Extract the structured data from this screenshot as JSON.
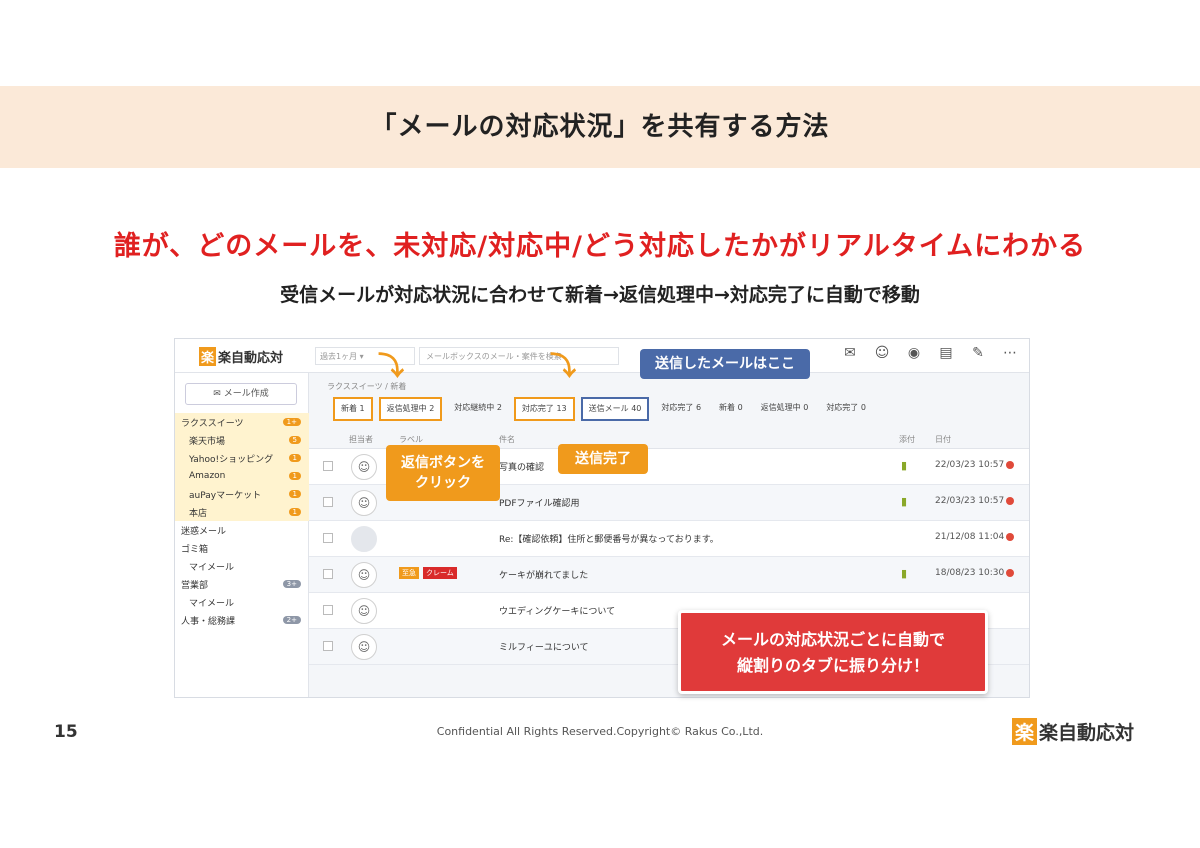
{
  "slide": {
    "title": "「メールの対応状況」を共有する方法",
    "headline": "誰が、どのメールを、未対応/対応中/どう対応したかがリアルタイムにわかる",
    "subline": "受信メールが対応状況に合わせて新着→返信処理中→対応完了に自動で移動",
    "page_number": "15",
    "copyright": "Confidential All Rights Reserved.Copyright© Rakus Co.,Ltd.",
    "logo_mark": "楽",
    "logo_text": "楽自動応対"
  },
  "app": {
    "logo_mark": "楽",
    "logo_text": "楽自動応対",
    "period": "過去1ヶ月",
    "search_placeholder": "メールボックスのメール・案件を検索",
    "top_icons": [
      "mail-icon",
      "smile-icon",
      "badge-icon",
      "document-icon",
      "chat-icon",
      "more-icon"
    ],
    "compose_label": "メール作成",
    "folders": [
      {
        "label": "ラクススイーツ",
        "count": "1+",
        "highlight": true
      },
      {
        "label": "楽天市場",
        "count": "5",
        "highlight": true
      },
      {
        "label": "Yahoo!ショッピング",
        "count": "1",
        "highlight": true
      },
      {
        "label": "Amazon",
        "count": "1",
        "highlight": true
      },
      {
        "label": "auPayマーケット",
        "count": "1",
        "highlight": true
      },
      {
        "label": "本店",
        "count": "1",
        "highlight": true
      },
      {
        "label": "迷惑メール",
        "count": ""
      },
      {
        "label": "ゴミ箱",
        "count": ""
      },
      {
        "label": "マイメール",
        "count": ""
      },
      {
        "label": "営業部",
        "count": "3+"
      },
      {
        "label": "マイメール",
        "count": ""
      },
      {
        "label": "人事・総務課",
        "count": "2+"
      }
    ],
    "breadcrumb": "ラクススイーツ / 新着",
    "tabs": [
      {
        "label": "新着",
        "count": "1",
        "style": "orange"
      },
      {
        "label": "返信処理中",
        "count": "2",
        "style": "orange"
      },
      {
        "label": "対応継続中",
        "count": "2",
        "style": "plain"
      },
      {
        "label": "対応完了",
        "count": "13",
        "style": "orange"
      },
      {
        "label": "送信メール",
        "count": "40",
        "style": "blue"
      },
      {
        "label": "対応完了",
        "count": "6",
        "style": "plain"
      },
      {
        "label": "新着",
        "count": "0",
        "style": "plain"
      },
      {
        "label": "返信処理中",
        "count": "0",
        "style": "plain"
      },
      {
        "label": "対応完了",
        "count": "0",
        "style": "plain"
      }
    ],
    "columns": {
      "assignee": "担当者",
      "label": "ラベル",
      "subject": "件名",
      "attach": "添付",
      "date": "日付"
    },
    "rows": [
      {
        "subject": "写真の確認",
        "date": "22/03/23 10:57",
        "attach": true,
        "avatar": true,
        "tags": []
      },
      {
        "subject": "PDFファイル確認用",
        "date": "22/03/23 10:57",
        "attach": true,
        "avatar": true,
        "tags": []
      },
      {
        "subject": "Re:【確認依頼】住所と郵便番号が異なっております。",
        "date": "21/12/08 11:04",
        "attach": false,
        "avatar": false,
        "tags": []
      },
      {
        "subject": "ケーキが崩れてました",
        "date": "18/08/23 10:30",
        "attach": true,
        "avatar": true,
        "tags": [
          "至急",
          "クレーム"
        ]
      },
      {
        "subject": "ウエディングケーキについて",
        "date": "",
        "attach": false,
        "avatar": true,
        "tags": []
      },
      {
        "subject": "ミルフィーユについて",
        "date": "",
        "attach": false,
        "avatar": true,
        "tags": []
      }
    ]
  },
  "callouts": {
    "reply_click": [
      "返信ボタンを",
      "クリック"
    ],
    "sent_done": "送信完了",
    "sent_here": "送信したメールはここ",
    "auto_sort": [
      "メールの対応状況ごとに自動で",
      "縦割りのタブに振り分け！"
    ]
  }
}
